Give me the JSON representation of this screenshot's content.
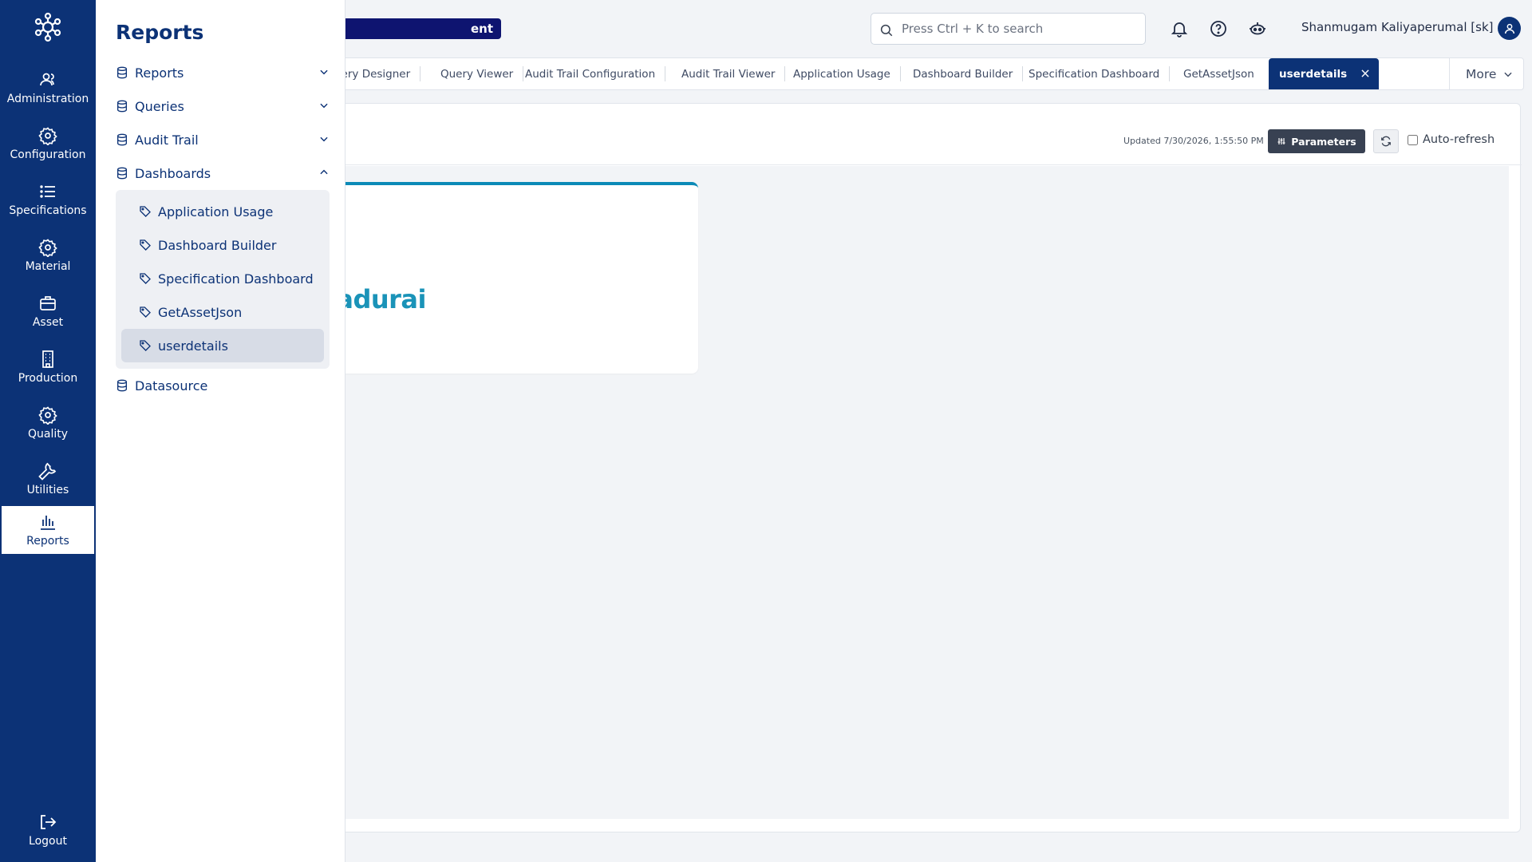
{
  "rail": {
    "items": [
      {
        "label": "Administration",
        "icon": "users-icon"
      },
      {
        "label": "Configuration",
        "icon": "gear-icon"
      },
      {
        "label": "Specifications",
        "icon": "list-icon"
      },
      {
        "label": "Material",
        "icon": "gear-icon"
      },
      {
        "label": "Asset",
        "icon": "briefcase-icon"
      },
      {
        "label": "Production",
        "icon": "building-icon"
      },
      {
        "label": "Quality",
        "icon": "gear-icon"
      },
      {
        "label": "Utilities",
        "icon": "wrench-icon"
      },
      {
        "label": "Reports",
        "icon": "bar-chart-icon",
        "active": true
      }
    ],
    "logout_label": "Logout"
  },
  "flyout": {
    "title": "Reports",
    "items": [
      {
        "label": "Reports",
        "expanded": false
      },
      {
        "label": "Queries",
        "expanded": false
      },
      {
        "label": "Audit Trail",
        "expanded": false
      },
      {
        "label": "Dashboards",
        "expanded": true
      }
    ],
    "dashboards": [
      {
        "label": "Application Usage"
      },
      {
        "label": "Dashboard Builder"
      },
      {
        "label": "Specification Dashboard"
      },
      {
        "label": "GetAssetJson"
      },
      {
        "label": "userdetails",
        "active": true
      }
    ],
    "datasource_label": "Datasource"
  },
  "header": {
    "badge_text": "ent",
    "search_placeholder": "Press Ctrl + K to search",
    "user_name": "Shanmugam Kaliyaperumal [sk]"
  },
  "tabs": {
    "items": [
      "uery Designer",
      "Query Viewer",
      "Audit Trail Configuration",
      "Audit Trail Viewer",
      "Application Usage",
      "Dashboard Builder",
      "Specification Dashboard",
      "GetAssetJson"
    ],
    "active": "userdetails",
    "more_label": "More"
  },
  "content": {
    "updated_text": "Updated 7/30/2026, 1:55:50 PM",
    "parameters_label": "Parameters",
    "auto_refresh_label": "Auto-refresh",
    "auto_refresh_checked": false,
    "widget_value": "vadurai"
  },
  "colors": {
    "brand": "#0c3276",
    "accent": "#1a93b8",
    "badge": "#0e1470"
  }
}
